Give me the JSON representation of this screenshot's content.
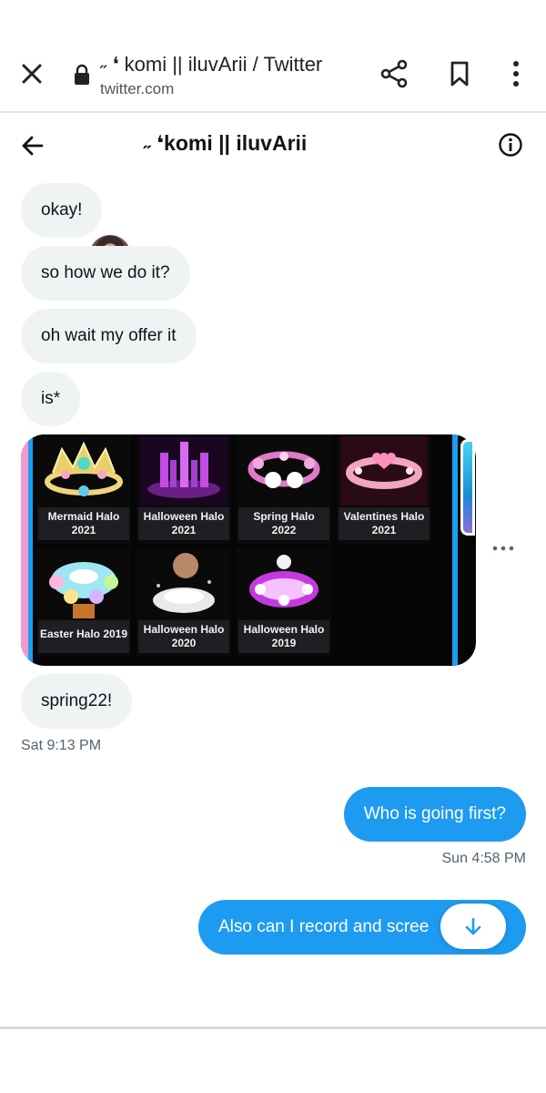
{
  "browser": {
    "title": "˶ ❛ komi || iluvArii / Twitter",
    "domain": "twitter.com",
    "icons": [
      "close-icon",
      "lock-icon",
      "share-icon",
      "bookmark-icon",
      "more-vertical-icon"
    ]
  },
  "conversation": {
    "name": "˶ ❛komi || iluvArii",
    "icons": [
      "back-arrow-icon",
      "info-icon"
    ]
  },
  "messages": {
    "m1": "okay!",
    "m2": "so how we do it?",
    "m3": "oh wait my offer it",
    "m4": "is*",
    "m5": "spring22!",
    "ts1": "Sat 9:13 PM",
    "s1": "Who is going first?",
    "ts2": "Sun 4:58 PM",
    "s2": "Also can I record and scree"
  },
  "halos": [
    {
      "line1": "Mermaid Halo",
      "line2": "2021"
    },
    {
      "line1": "Halloween Halo",
      "line2": "2021"
    },
    {
      "line1": "Spring Halo",
      "line2": "2022"
    },
    {
      "line1": "Valentines Halo",
      "line2": "2021"
    },
    {
      "line1": "Easter Halo 2019",
      "line2": ""
    },
    {
      "line1": "Halloween Halo",
      "line2": "2020"
    },
    {
      "line1": "Halloween Halo",
      "line2": "2019"
    }
  ],
  "colors": {
    "accent": "#1d9bf0",
    "received_bubble": "#eff3f4",
    "timestamp": "#536471"
  }
}
